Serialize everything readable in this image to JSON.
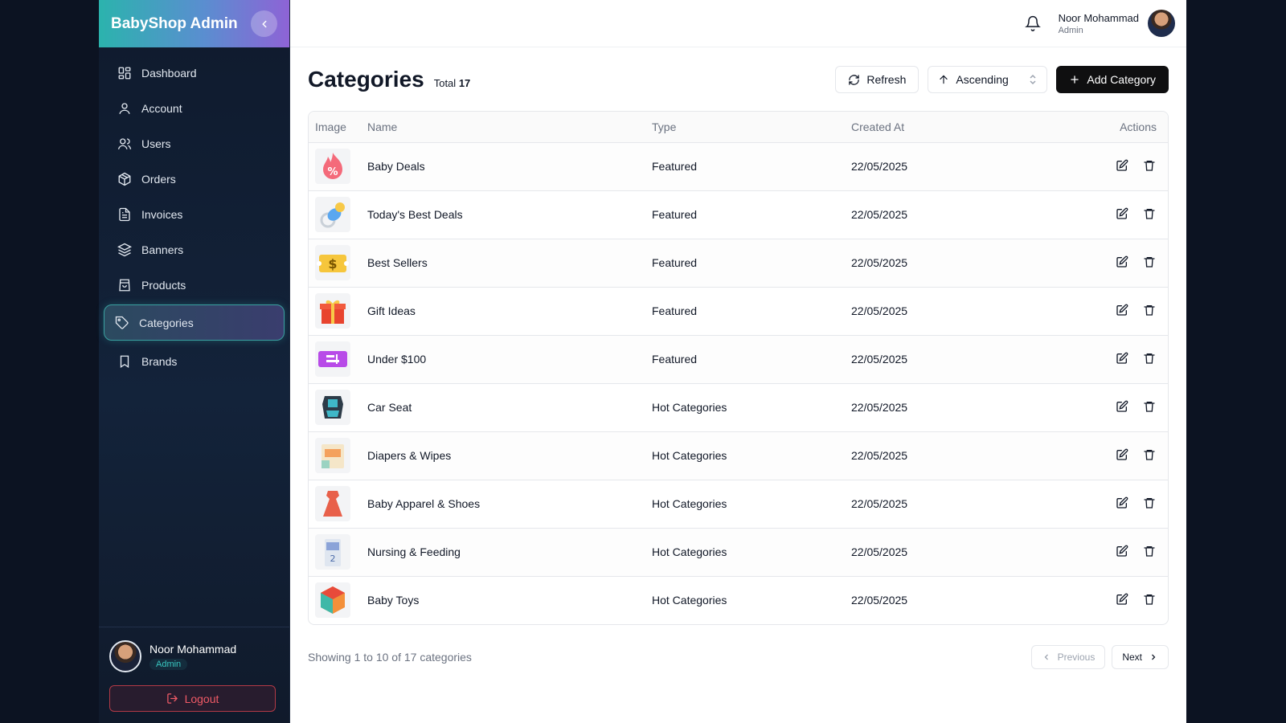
{
  "app": {
    "title": "BabyShop Admin"
  },
  "sidebar": {
    "items": [
      {
        "label": "Dashboard",
        "icon": "dashboard-icon"
      },
      {
        "label": "Account",
        "icon": "user-icon"
      },
      {
        "label": "Users",
        "icon": "users-icon"
      },
      {
        "label": "Orders",
        "icon": "package-icon"
      },
      {
        "label": "Invoices",
        "icon": "file-icon"
      },
      {
        "label": "Banners",
        "icon": "layers-icon"
      },
      {
        "label": "Products",
        "icon": "shopping-bag-icon"
      },
      {
        "label": "Categories",
        "icon": "tag-icon",
        "active": true
      },
      {
        "label": "Brands",
        "icon": "bookmark-icon"
      }
    ],
    "user": {
      "name": "Noor Mohammad",
      "role": "Admin"
    },
    "logout_label": "Logout"
  },
  "topbar": {
    "user_name": "Noor Mohammad",
    "user_role": "Admin"
  },
  "page": {
    "title": "Categories",
    "total_label": "Total",
    "total_count": "17",
    "refresh_label": "Refresh",
    "sort_label": "Ascending",
    "add_label": "Add Category"
  },
  "table": {
    "headers": [
      "Image",
      "Name",
      "Type",
      "Created At",
      "Actions"
    ],
    "rows": [
      {
        "name": "Baby Deals",
        "type": "Featured",
        "created": "22/05/2025",
        "thumb": "percent-flame"
      },
      {
        "name": "Today's Best Deals",
        "type": "Featured",
        "created": "22/05/2025",
        "thumb": "pacifier"
      },
      {
        "name": "Best Sellers",
        "type": "Featured",
        "created": "22/05/2025",
        "thumb": "dollar-ticket"
      },
      {
        "name": "Gift Ideas",
        "type": "Featured",
        "created": "22/05/2025",
        "thumb": "gift-box"
      },
      {
        "name": "Under $100",
        "type": "Featured",
        "created": "22/05/2025",
        "thumb": "coupon"
      },
      {
        "name": "Car Seat",
        "type": "Hot Categories",
        "created": "22/05/2025",
        "thumb": "car-seat"
      },
      {
        "name": "Diapers & Wipes",
        "type": "Hot Categories",
        "created": "22/05/2025",
        "thumb": "diapers"
      },
      {
        "name": "Baby Apparel & Shoes",
        "type": "Hot Categories",
        "created": "22/05/2025",
        "thumb": "apparel"
      },
      {
        "name": "Nursing & Feeding",
        "type": "Hot Categories",
        "created": "22/05/2025",
        "thumb": "formula"
      },
      {
        "name": "Baby Toys",
        "type": "Hot Categories",
        "created": "22/05/2025",
        "thumb": "toy-cube"
      }
    ]
  },
  "pagination": {
    "showing": "Showing 1 to 10 of 17 categories",
    "prev_label": "Previous",
    "next_label": "Next"
  },
  "colors": {
    "accent_teal": "#2bb3ad",
    "accent_purple": "#8e63d6",
    "danger": "#ef5a66",
    "primary_button": "#0f0f10"
  }
}
